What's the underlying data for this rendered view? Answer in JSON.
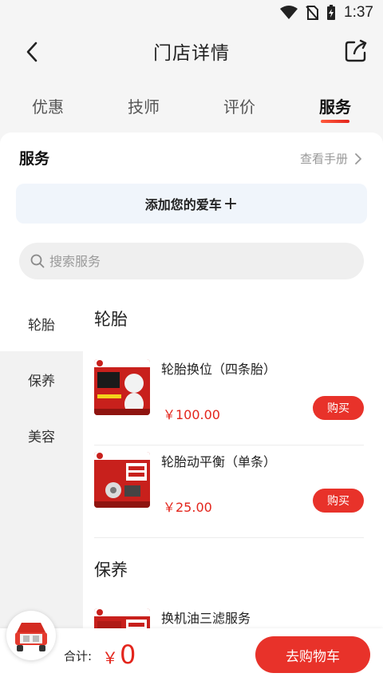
{
  "status_bar": {
    "time": "1:37"
  },
  "header": {
    "title": "门店详情",
    "back_icon": "chevron-left-icon",
    "share_icon": "share-icon"
  },
  "tabs": [
    {
      "label": "优惠",
      "active": false
    },
    {
      "label": "技师",
      "active": false
    },
    {
      "label": "评价",
      "active": false
    },
    {
      "label": "服务",
      "active": true
    }
  ],
  "service": {
    "heading": "服务",
    "manual_link": "查看手册",
    "add_car_label": "添加您的爱车",
    "add_car_plus": "+",
    "search_placeholder": "搜索服务"
  },
  "categories": [
    {
      "label": "轮胎",
      "active": true
    },
    {
      "label": "保养",
      "active": false
    },
    {
      "label": "美容",
      "active": false
    }
  ],
  "groups": [
    {
      "title": "轮胎",
      "products": [
        {
          "name": "轮胎换位（四条胎）",
          "price": "￥100.00",
          "buy_label": "购买"
        },
        {
          "name": "轮胎动平衡（单条）",
          "price": "￥25.00",
          "buy_label": "购买"
        }
      ]
    },
    {
      "title": "保养",
      "products": [
        {
          "name": "换机油三滤服务",
          "price": "",
          "buy_label": ""
        }
      ]
    }
  ],
  "bottom_bar": {
    "total_label": "合计:",
    "currency": "￥",
    "total_value": "0",
    "checkout_label": "去购物车"
  },
  "colors": {
    "accent": "#e8322a",
    "price": "#e3251c"
  }
}
